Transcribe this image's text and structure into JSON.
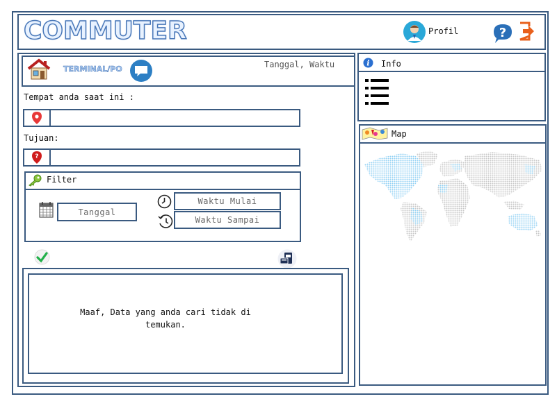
{
  "app": {
    "title": "COMMUTER"
  },
  "header": {
    "profile_label": "Profil",
    "icons": {
      "profile": "user-avatar-icon",
      "help": "help-bubble-icon",
      "logout": "logout-icon"
    }
  },
  "main": {
    "terminal_label": "TERMINAL/PO",
    "datetime_label": "Tanggal, Waktu",
    "origin_label": "Tempat anda saat ini :",
    "origin_value": "",
    "destination_label": "Tujuan:",
    "destination_value": "",
    "filter": {
      "title": "Filter",
      "date_button": "Tanggal",
      "start_time_button": "Waktu Mulai",
      "end_time_button": "Waktu Sampai"
    },
    "result_message": "Maaf, Data yang anda cari tidak di temukan."
  },
  "info": {
    "title": "Info"
  },
  "map": {
    "title": "Map"
  },
  "colors": {
    "border": "#3a5a80",
    "accent": "#2d7fc4",
    "logout": "#e8601c",
    "map_land": "#d0d0d0",
    "map_highlight": "#8fd0f4"
  }
}
